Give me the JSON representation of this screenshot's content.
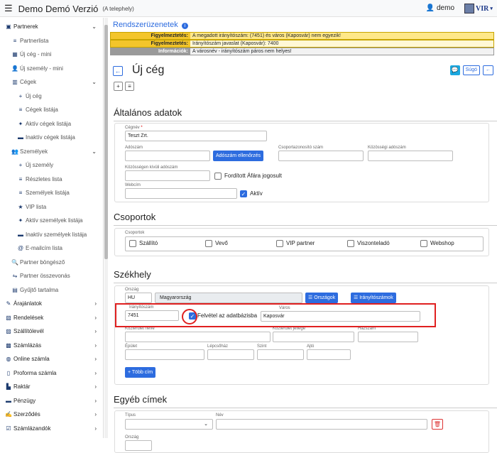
{
  "app": {
    "title": "Demo Demó Verzió",
    "subtitle": "(A telephely)",
    "user": "demo",
    "logo_text": "VIR"
  },
  "sidebar": [
    {
      "label": "Partnerek",
      "icon": "building-icon",
      "level": 0,
      "chev": "⌄"
    },
    {
      "label": "Partnerlista",
      "icon": "list-icon",
      "level": 1
    },
    {
      "label": "Új cég - mini",
      "icon": "building-plus-icon",
      "level": 1
    },
    {
      "label": "Új személy - mini",
      "icon": "user-plus-icon",
      "level": 1
    },
    {
      "label": "Cégek",
      "icon": "company-icon",
      "level": 1,
      "chev": "⌄"
    },
    {
      "label": "Új cég",
      "icon": "plus-icon",
      "level": 2
    },
    {
      "label": "Cégek listája",
      "icon": "list-icon",
      "level": 2
    },
    {
      "label": "Aktív cégek listája",
      "icon": "active-icon",
      "level": 2
    },
    {
      "label": "Inaktív cégek listája",
      "icon": "inactive-icon",
      "level": 2
    },
    {
      "label": "Személyek",
      "icon": "users-icon",
      "level": 1,
      "chev": "⌄"
    },
    {
      "label": "Új személy",
      "icon": "plus-icon",
      "level": 2
    },
    {
      "label": "Részletes lista",
      "icon": "list-icon",
      "level": 2
    },
    {
      "label": "Személyek listája",
      "icon": "list-icon",
      "level": 2
    },
    {
      "label": "VIP lista",
      "icon": "vip-icon",
      "level": 2
    },
    {
      "label": "Aktív személyek listája",
      "icon": "active-icon",
      "level": 2
    },
    {
      "label": "Inaktív személyek listája",
      "icon": "inactive-icon",
      "level": 2
    },
    {
      "label": "E-mailcím lista",
      "icon": "at-icon",
      "level": 2
    },
    {
      "label": "Partner böngésző",
      "icon": "search-icon",
      "level": 1
    },
    {
      "label": "Partner összevonás",
      "icon": "merge-icon",
      "level": 1
    },
    {
      "label": "Gyűjtő tartalma",
      "icon": "box-icon",
      "level": 1
    },
    {
      "label": "Árajánlatok",
      "icon": "offer-icon",
      "level": 0,
      "chev": "›"
    },
    {
      "label": "Rendelések",
      "icon": "order-icon",
      "level": 0,
      "chev": "›"
    },
    {
      "label": "Szállítólevél",
      "icon": "truck-icon",
      "level": 0,
      "chev": "›"
    },
    {
      "label": "Számlázás",
      "icon": "invoice-icon",
      "level": 0,
      "chev": "›"
    },
    {
      "label": "Online számla",
      "icon": "globe-icon",
      "level": 0,
      "chev": "›"
    },
    {
      "label": "Proforma számla",
      "icon": "doc-icon",
      "level": 0,
      "chev": "›"
    },
    {
      "label": "Raktár",
      "icon": "warehouse-icon",
      "level": 0,
      "chev": "›"
    },
    {
      "label": "Pénzügy",
      "icon": "money-icon",
      "level": 0,
      "chev": "›"
    },
    {
      "label": "Szerződés",
      "icon": "contract-icon",
      "level": 0,
      "chev": "›"
    },
    {
      "label": "Számlázandók",
      "icon": "todo-icon",
      "level": 0,
      "chev": "›"
    }
  ],
  "messages": {
    "title": "Rendszerüzenetek",
    "rows": [
      {
        "type": "warn",
        "label": "Figyelmeztetés:",
        "text": "A megadott irányítószám: (7451) és város (Kaposvár) nem egyezik!"
      },
      {
        "type": "warn2",
        "label": "Figyelmeztetés:",
        "text": "Irányítószám javaslat (Kaposvár): 7400"
      },
      {
        "type": "info",
        "label": "Információk:",
        "text": "A városnév - irányítószám páros nem helyes!"
      }
    ]
  },
  "page": {
    "title": "Új cég",
    "help": "Súgó"
  },
  "general": {
    "title": "Általános adatok",
    "company_label": "Cégnév",
    "company_value": "Teszt Zrt.",
    "tax_label": "Adószám",
    "tax_check": "Adószám ellenőrzés",
    "group_tax_label": "Csoportazonosító szám",
    "eu_tax_label": "Közösségi adószám",
    "non_eu_tax_label": "Közösségen kívüli adószám",
    "reverse_vat_label": "Fordított Áfára jogosult",
    "web_label": "Webcím",
    "active_label": "Aktív"
  },
  "groups": {
    "title": "Csoportok",
    "field_label": "Csoportok",
    "items": [
      "Szállító",
      "Vevő",
      "VIP partner",
      "Viszonteladó",
      "Webshop"
    ]
  },
  "seat": {
    "title": "Székhely",
    "country_label": "Ország",
    "country_code": "HU",
    "country_name": "Magyarország",
    "countries_btn": "Országok",
    "zips_btn": "Irányítószámok",
    "zip_label": "Irányítószám",
    "zip_value": "7451",
    "add_db_label": "Felvétel az adatbázisba",
    "city_label": "Város",
    "city_value": "Kaposvár",
    "street_label": "Közterület neve",
    "street_type_label": "Közterület jellege",
    "house_label": "Házszám",
    "building_label": "Épület",
    "stairs_label": "Lépcsőház",
    "floor_label": "Szint",
    "door_label": "Ajtó",
    "more_btn": "Több cím"
  },
  "other": {
    "title": "Egyéb címek",
    "type_label": "Típus",
    "name_label": "Név",
    "country_label": "Ország"
  }
}
